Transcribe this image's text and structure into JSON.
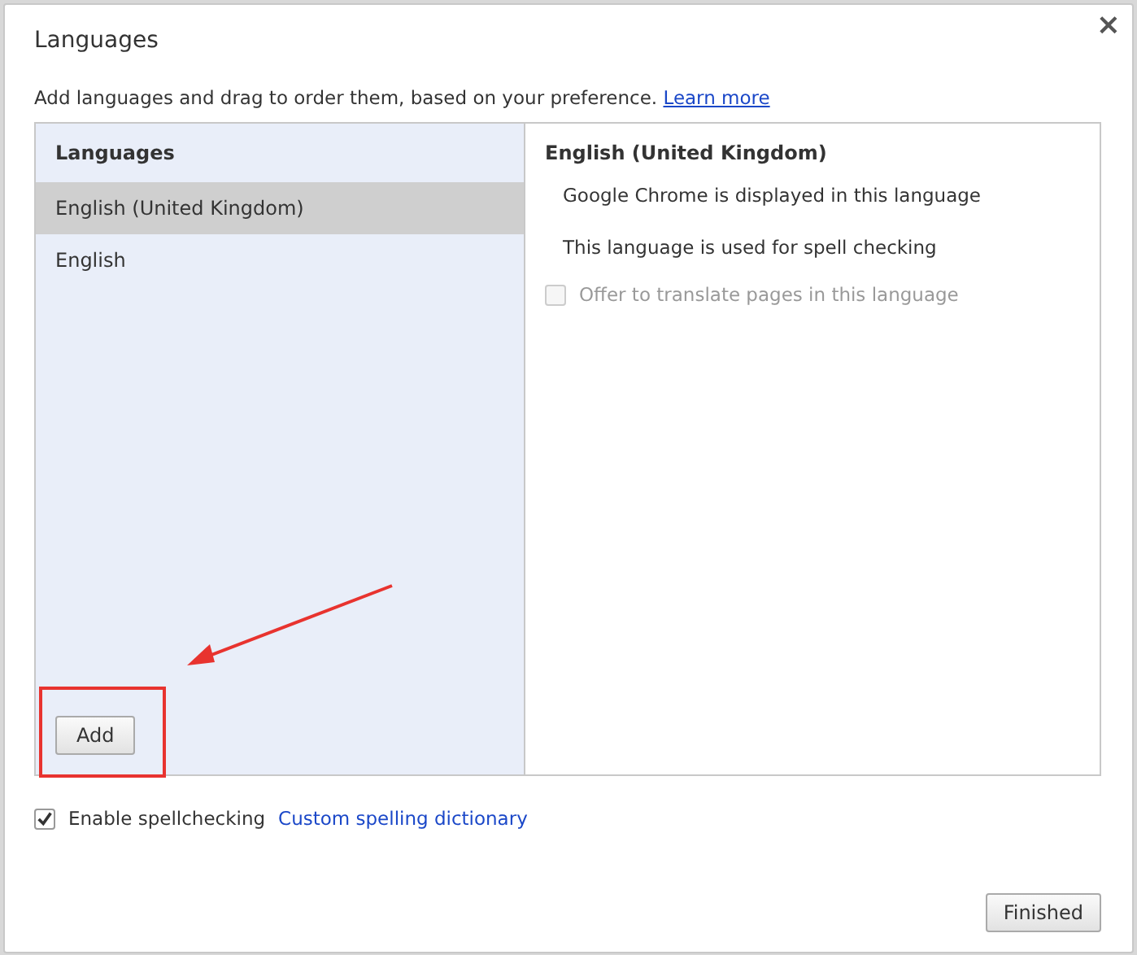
{
  "dialog": {
    "title": "Languages",
    "close": "×",
    "description": "Add languages and drag to order them, based on your preference.",
    "learn_more": "Learn more"
  },
  "languages": {
    "heading": "Languages",
    "items": [
      {
        "label": "English (United Kingdom)",
        "selected": true
      },
      {
        "label": "English",
        "selected": false
      }
    ],
    "add_button": "Add"
  },
  "details": {
    "title": "English (United Kingdom)",
    "notes": [
      "Google Chrome is displayed in this language",
      "This language is used for spell checking"
    ],
    "translate_option": {
      "label": "Offer to translate pages in this language",
      "checked": false,
      "disabled": true
    }
  },
  "spellcheck": {
    "label": "Enable spellchecking",
    "checked": true,
    "link": "Custom spelling dictionary"
  },
  "buttons": [
    "Finished"
  ]
}
